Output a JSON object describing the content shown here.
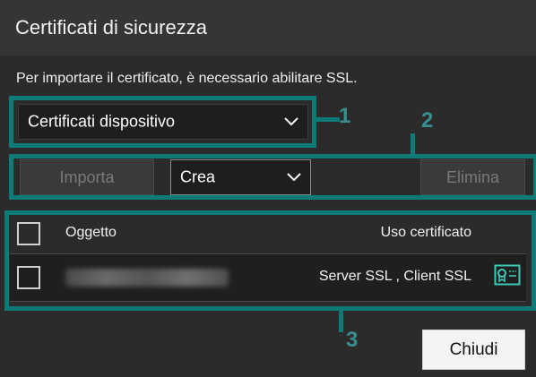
{
  "dialog": {
    "title": "Certificati di sicurezza",
    "notice": "Per importare il certificato, è necessario abilitare SSL."
  },
  "certificate_source": {
    "selected": "Certificati dispositivo"
  },
  "toolbar": {
    "import_label": "Importa",
    "create_label": "Crea",
    "delete_label": "Elimina"
  },
  "table": {
    "columns": [
      "Oggetto",
      "Uso certificato"
    ],
    "rows": [
      {
        "object": "",
        "usage": "Server SSL , Client SSL",
        "icon": "certificate-icon"
      }
    ]
  },
  "footer": {
    "close_label": "Chiudi"
  },
  "annotations": [
    "1",
    "2",
    "3"
  ],
  "colors": {
    "annotation": "#0f7a78",
    "background": "#2b2b2b",
    "icon_teal": "#3ec9b6"
  }
}
